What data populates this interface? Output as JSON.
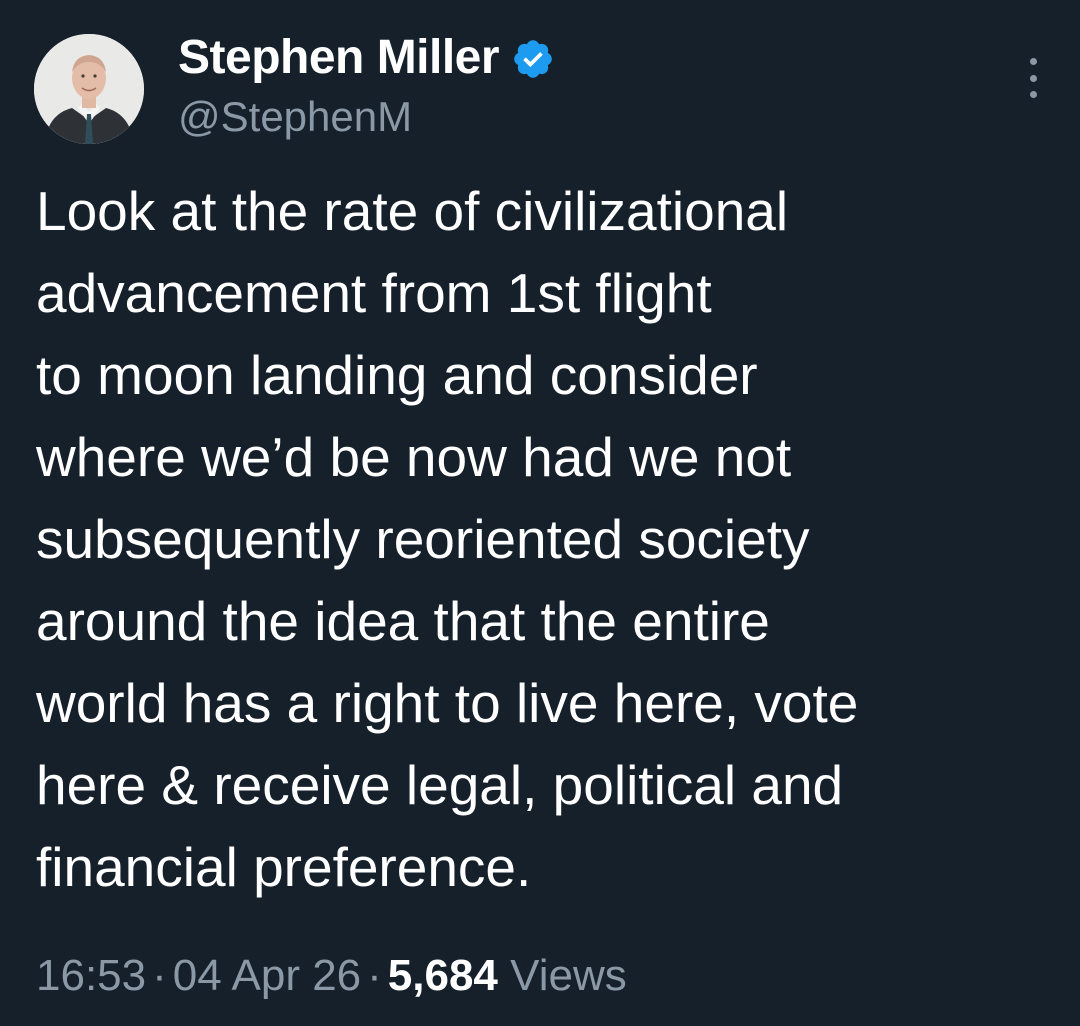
{
  "author": {
    "display_name": "Stephen Miller",
    "handle": "@StephenM",
    "avatar_icon": "profile-photo",
    "verified_icon": "verified-badge-icon",
    "verified_color": "#1d9bf0"
  },
  "menu": {
    "icon": "more-options-icon"
  },
  "tweet": {
    "lines": [
      "Look at the rate of civilizational",
      "advancement from 1st flight",
      "to moon landing and consider",
      "where we’d be now had we not",
      "subsequently reoriented society",
      "around the idea that the entire",
      "world has a right to live here, vote",
      "here & receive legal, political and",
      "financial preference."
    ]
  },
  "meta": {
    "time": "16:53",
    "separator": "·",
    "date": "04 Apr 26",
    "views_count": "5,684",
    "views_label": "Views"
  },
  "colors": {
    "background": "#15202b",
    "secondary_text": "#8b98a5",
    "primary_text": "#ffffff"
  }
}
